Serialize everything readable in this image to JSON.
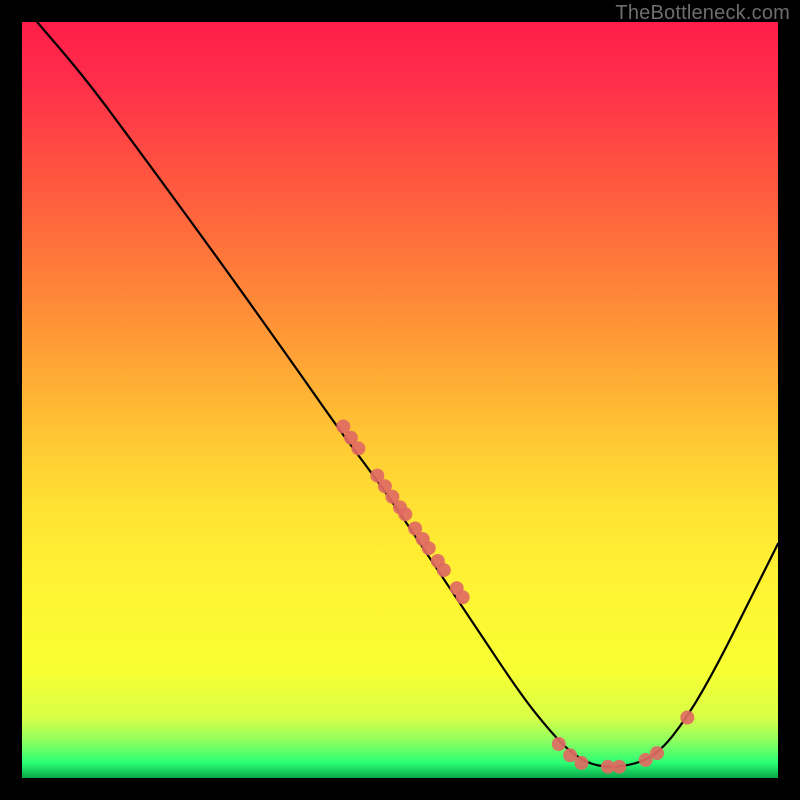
{
  "watermark": "TheBottleneck.com",
  "chart_data": {
    "type": "line",
    "title": "",
    "xlabel": "",
    "ylabel": "",
    "xlim": [
      0,
      100
    ],
    "ylim": [
      0,
      100
    ],
    "curve": [
      {
        "x": 2,
        "y": 100
      },
      {
        "x": 8,
        "y": 93
      },
      {
        "x": 14,
        "y": 85
      },
      {
        "x": 25,
        "y": 70
      },
      {
        "x": 35,
        "y": 56
      },
      {
        "x": 42,
        "y": 46
      },
      {
        "x": 48,
        "y": 38
      },
      {
        "x": 54,
        "y": 29
      },
      {
        "x": 60,
        "y": 20
      },
      {
        "x": 66,
        "y": 11
      },
      {
        "x": 70,
        "y": 6
      },
      {
        "x": 73,
        "y": 3
      },
      {
        "x": 76,
        "y": 1.5
      },
      {
        "x": 80,
        "y": 1.5
      },
      {
        "x": 84,
        "y": 3
      },
      {
        "x": 88,
        "y": 8
      },
      {
        "x": 92,
        "y": 15
      },
      {
        "x": 96,
        "y": 23
      },
      {
        "x": 100,
        "y": 31
      }
    ],
    "series": [
      {
        "name": "markers",
        "points": [
          {
            "x": 42.5,
            "y": 46.5
          },
          {
            "x": 43.5,
            "y": 45.0
          },
          {
            "x": 44.5,
            "y": 43.6
          },
          {
            "x": 47.0,
            "y": 40.0
          },
          {
            "x": 48.0,
            "y": 38.6
          },
          {
            "x": 49.0,
            "y": 37.2
          },
          {
            "x": 50.0,
            "y": 35.8
          },
          {
            "x": 50.7,
            "y": 34.9
          },
          {
            "x": 52.0,
            "y": 33.0
          },
          {
            "x": 53.0,
            "y": 31.6
          },
          {
            "x": 53.8,
            "y": 30.4
          },
          {
            "x": 55.0,
            "y": 28.7
          },
          {
            "x": 55.8,
            "y": 27.5
          },
          {
            "x": 57.5,
            "y": 25.1
          },
          {
            "x": 58.3,
            "y": 23.9
          },
          {
            "x": 71.0,
            "y": 4.5
          },
          {
            "x": 72.5,
            "y": 3.0
          },
          {
            "x": 74.0,
            "y": 2.0
          },
          {
            "x": 77.5,
            "y": 1.5
          },
          {
            "x": 79.0,
            "y": 1.5
          },
          {
            "x": 82.5,
            "y": 2.4
          },
          {
            "x": 84.0,
            "y": 3.3
          },
          {
            "x": 88.0,
            "y": 8.0
          }
        ]
      }
    ],
    "marker_color": "#e06a62",
    "curve_color": "#000000"
  }
}
